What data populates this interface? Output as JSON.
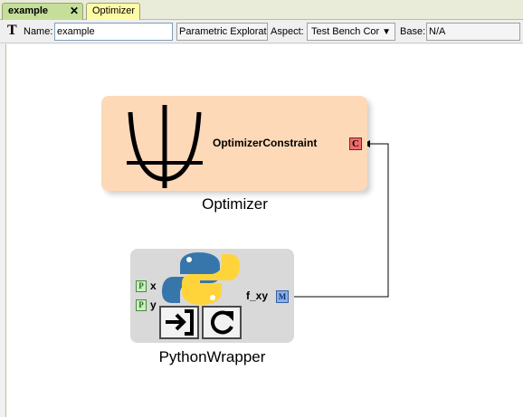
{
  "tabs": [
    {
      "label": "example",
      "close": "✕",
      "active": true
    },
    {
      "label": "Optimizer",
      "active": false
    }
  ],
  "toolbar": {
    "name_label": "Name:",
    "name_value": "example",
    "type_value": "Parametric Exploratio",
    "aspect_label": "Aspect:",
    "aspect_value": "Test Bench Cor",
    "base_label": "Base:",
    "base_value": "N/A",
    "tool_icon": "text-icon"
  },
  "canvas": {
    "optimizer": {
      "label": "Optimizer",
      "port_name": "OptimizerConstraint",
      "port_badge": "C",
      "icon": "parabola-icon"
    },
    "python_wrapper": {
      "label": "PythonWrapper",
      "inputs": [
        {
          "name": "x",
          "badge": "P"
        },
        {
          "name": "y",
          "badge": "P"
        }
      ],
      "output": {
        "name": "f_xy",
        "badge": "M"
      },
      "icons": [
        "python-logo",
        "import-icon",
        "refresh-icon"
      ]
    },
    "connection": {
      "from": "f_xy",
      "to": "OptimizerConstraint"
    }
  },
  "colors": {
    "optimizer_fill": "#fed9b8",
    "wrapper_fill": "#d9d9d9",
    "port_c": "#f06b6b",
    "port_p": "#c9f0c0",
    "port_m": "#84b3f0",
    "python_blue": "#3776ab",
    "python_yellow": "#ffd43b"
  }
}
